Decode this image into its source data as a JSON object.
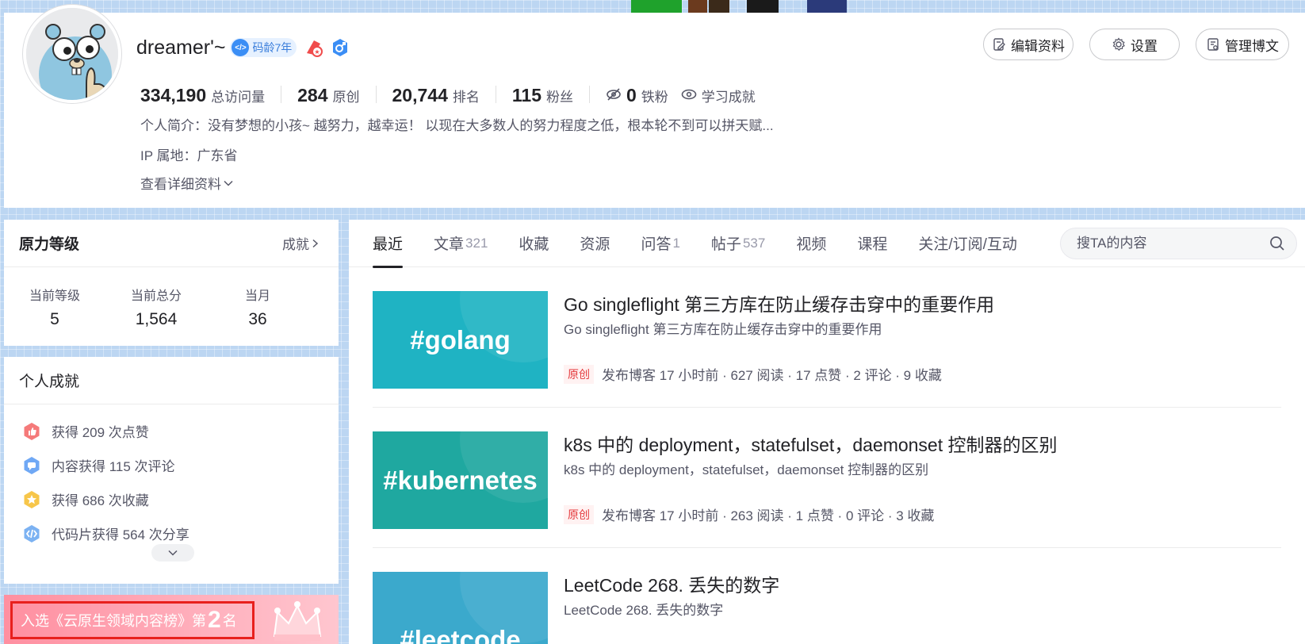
{
  "profile": {
    "username": "dreamer'~",
    "code_age": "码龄7年",
    "stats": [
      {
        "num": "334,190",
        "label": "总访问量"
      },
      {
        "num": "284",
        "label": "原创"
      },
      {
        "num": "20,744",
        "label": "排名"
      },
      {
        "num": "115",
        "label": "粉丝"
      }
    ],
    "iron_fans": {
      "num": "0",
      "label": "铁粉"
    },
    "learning": "学习成就",
    "bio": "个人简介：没有梦想的小孩~ 越努力，越幸运！ 以现在大多数人的努力程度之低，根本轮不到可以拼天赋...",
    "ip": "IP 属地：广东省",
    "detail_link": "查看详细资料"
  },
  "top_buttons": {
    "edit": "编辑资料",
    "settings": "设置",
    "manage": "管理博文"
  },
  "level_card": {
    "title": "原力等级",
    "link": "成就",
    "items": [
      {
        "label": "当前等级",
        "value": "5"
      },
      {
        "label": "当前总分",
        "value": "1,564"
      },
      {
        "label": "当月",
        "value": "36"
      }
    ]
  },
  "achievements": {
    "title": "个人成就",
    "items": [
      {
        "text": "获得 209 次点赞",
        "icon": "thumb-up-icon",
        "color": "#f04c4c"
      },
      {
        "text": "内容获得 115 次评论",
        "icon": "comment-icon",
        "color": "#4a90f0"
      },
      {
        "text": "获得 686 次收藏",
        "icon": "star-icon",
        "color": "#f7b731"
      },
      {
        "text": "代码片获得 564 次分享",
        "icon": "code-icon",
        "color": "#4a9cf0"
      }
    ]
  },
  "ranking": {
    "prefix": "入选《云原生领域内容榜》第",
    "rank": "2",
    "suffix": "名"
  },
  "tabs": [
    {
      "label": "最近",
      "count": "",
      "active": true
    },
    {
      "label": "文章",
      "count": "321"
    },
    {
      "label": "收藏",
      "count": ""
    },
    {
      "label": "资源",
      "count": ""
    },
    {
      "label": "问答",
      "count": "1"
    },
    {
      "label": "帖子",
      "count": "537"
    },
    {
      "label": "视频",
      "count": ""
    },
    {
      "label": "课程",
      "count": ""
    },
    {
      "label": "关注/订阅/互动",
      "count": ""
    }
  ],
  "search": {
    "placeholder": "搜TA的内容"
  },
  "articles": [
    {
      "thumb_tag": "#golang",
      "thumb_color": "#1fb3c3",
      "title": "Go singleflight 第三方库在防止缓存击穿中的重要作用",
      "summary": "Go singleflight 第三方库在防止缓存击穿中的重要作用",
      "badge": "原创",
      "meta": "发布博客 17 小时前 ·  627 阅读 ·  17 点赞 ·  2 评论 ·  9 收藏"
    },
    {
      "thumb_tag": "#kubernetes",
      "thumb_color": "#1fa8a0",
      "title": "k8s 中的 deployment，statefulset，daemonset 控制器的区别",
      "summary": "k8s 中的 deployment，statefulset，daemonset 控制器的区别",
      "badge": "原创",
      "meta": "发布博客 17 小时前 ·  263 阅读 ·  1 点赞 ·  0 评论 ·  3 收藏"
    },
    {
      "thumb_tag": "#leetcode",
      "thumb_color": "#3ba9cc",
      "title": "LeetCode 268. 丢失的数字",
      "summary": "LeetCode 268. 丢失的数字",
      "badge": "",
      "meta": ""
    }
  ]
}
